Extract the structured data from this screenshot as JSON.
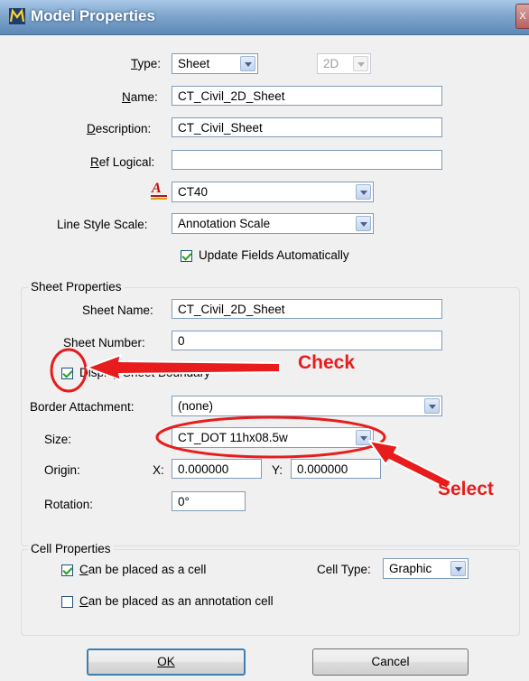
{
  "window": {
    "title": "Model Properties",
    "close_glyph": "X"
  },
  "model": {
    "type_label": "Type:",
    "type_value": "Sheet",
    "dim_value": "2D",
    "name_label": "Name:",
    "name_value": "CT_Civil_2D_Sheet",
    "description_label": "Description:",
    "description_value": "CT_Civil_Sheet",
    "ref_logical_label": "Ref Logical:",
    "ref_logical_value": "",
    "annotation_scale_value": "CT40",
    "line_style_scale_label": "Line Style Scale:",
    "line_style_scale_value": "Annotation Scale",
    "update_fields_label": "Update Fields Automatically",
    "update_fields_checked": true
  },
  "sheet_properties": {
    "group_title": "Sheet Properties",
    "sheet_name_label": "Sheet Name:",
    "sheet_name_value": "CT_Civil_2D_Sheet",
    "sheet_number_label": "Sheet Number:",
    "sheet_number_value": "0",
    "display_boundary_label": "Display Sheet Boundary",
    "display_boundary_checked": true,
    "border_attachment_label": "Border Attachment:",
    "border_attachment_value": "(none)",
    "size_label": "Size:",
    "size_value": "CT_DOT 11hx08.5w",
    "origin_label": "Origin:",
    "x_label": "X:",
    "origin_x": "0.000000",
    "y_label": "Y:",
    "origin_y": "0.000000",
    "rotation_label": "Rotation:",
    "rotation_value": "0°"
  },
  "cell_properties": {
    "group_title": "Cell Properties",
    "placed_as_cell_label": "Can be placed as a cell",
    "placed_as_cell_checked": true,
    "cell_type_label": "Cell Type:",
    "cell_type_value": "Graphic",
    "annotation_cell_label": "Can be placed as an annotation cell",
    "annotation_cell_checked": false
  },
  "buttons": {
    "ok": "OK",
    "cancel": "Cancel"
  },
  "annotations": {
    "check_text": "Check",
    "select_text": "Select",
    "color": "#e81c1c"
  },
  "icons": {
    "app": "microstation-icon",
    "annotation_scale": "annotation-scale-icon"
  }
}
